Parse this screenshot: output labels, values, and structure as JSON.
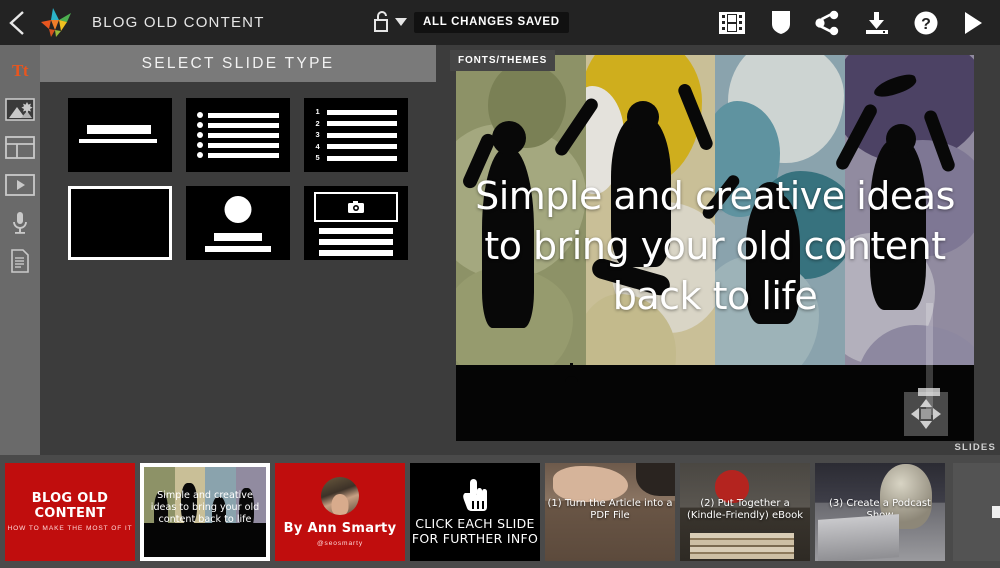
{
  "header": {
    "back_icon": "chevron-left-icon",
    "logo_icon": "app-logo-bird-icon",
    "doc_title": "BLOG OLD CONTENT",
    "lock_icon": "unlocked-padlock-icon",
    "lock_caret_icon": "chevron-down-icon",
    "save_status": "ALL CHANGES SAVED",
    "icons": [
      {
        "name": "film-strip-icon",
        "label": "Video"
      },
      {
        "name": "shield-badge-icon",
        "label": "Branding"
      },
      {
        "name": "share-icon",
        "label": "Share"
      },
      {
        "name": "download-icon",
        "label": "Download"
      },
      {
        "name": "help-question-icon",
        "label": "Help"
      },
      {
        "name": "play-icon",
        "label": "Play"
      }
    ]
  },
  "rail": {
    "items": [
      {
        "name": "text-tool",
        "icon": "text-tt-icon",
        "label": "Tt",
        "active": true
      },
      {
        "name": "image-tool",
        "icon": "image-icon",
        "active": false
      },
      {
        "name": "layout-tool",
        "icon": "layout-icon",
        "active": false
      },
      {
        "name": "video-tool",
        "icon": "video-play-icon",
        "active": false
      },
      {
        "name": "audio-tool",
        "icon": "microphone-icon",
        "active": false
      },
      {
        "name": "notes-tool",
        "icon": "document-icon",
        "active": false
      }
    ]
  },
  "panel": {
    "title": "SELECT SLIDE TYPE",
    "types": [
      {
        "name": "slide-type-title",
        "layout": "title",
        "selected": false
      },
      {
        "name": "slide-type-bullet-list",
        "layout": "bullets",
        "selected": false
      },
      {
        "name": "slide-type-numbered-list",
        "layout": "numbered",
        "selected": false,
        "numbers": [
          "1",
          "2",
          "3",
          "4",
          "5"
        ]
      },
      {
        "name": "slide-type-text-lines",
        "layout": "lines",
        "selected": true
      },
      {
        "name": "slide-type-profile",
        "layout": "profile",
        "selected": false
      },
      {
        "name": "slide-type-photo-caption",
        "layout": "photo",
        "selected": false
      }
    ]
  },
  "canvas": {
    "fonts_themes_label": "FONTS/THEMES",
    "slide_text": "Simple and creative ideas to bring your old content back to life",
    "stripe_colors": [
      "#8d9267",
      "#c9bf97",
      "#8aa3ad",
      "#918ba0"
    ],
    "slider_name": "size-slider",
    "move_pad_name": "move-resize-handle",
    "slides_label": "SLIDES"
  },
  "filmstrip": {
    "slides": [
      {
        "name": "thumb-slide-1",
        "kind": "red",
        "selected": false,
        "title": "BLOG OLD CONTENT",
        "subtitle": "HOW TO MAKE THE MOST OF IT"
      },
      {
        "name": "thumb-slide-2",
        "kind": "mini-canvas",
        "selected": true,
        "title": "Simple and creative ideas to bring your old content back to life"
      },
      {
        "name": "thumb-slide-3",
        "kind": "red-avatar",
        "selected": false,
        "title": "By Ann Smarty",
        "subtitle": "@seosmarty"
      },
      {
        "name": "thumb-slide-4",
        "kind": "black-hand",
        "selected": false,
        "title": "CLICK EACH SLIDE FOR FURTHER INFO"
      },
      {
        "name": "thumb-slide-5",
        "kind": "photo-pdf",
        "selected": false,
        "title": "(1) Turn the Article into a PDF File"
      },
      {
        "name": "thumb-slide-6",
        "kind": "photo-book",
        "selected": false,
        "title": "(2) Put Together a (Kindle-Friendly) eBook"
      },
      {
        "name": "thumb-slide-7",
        "kind": "photo-podcast",
        "selected": false,
        "title": "(3) Create a Podcast Show"
      }
    ],
    "add_button": {
      "name": "add-slide-button",
      "icon": "plus-icon"
    }
  },
  "colors": {
    "accent": "#e8561f",
    "header_bg": "#232323",
    "panel_bg": "#3c3c3c",
    "rail_bg": "#6a6a6a",
    "filmstrip_bg": "#4a4a4a",
    "thumb_red": "#c00d0d"
  }
}
